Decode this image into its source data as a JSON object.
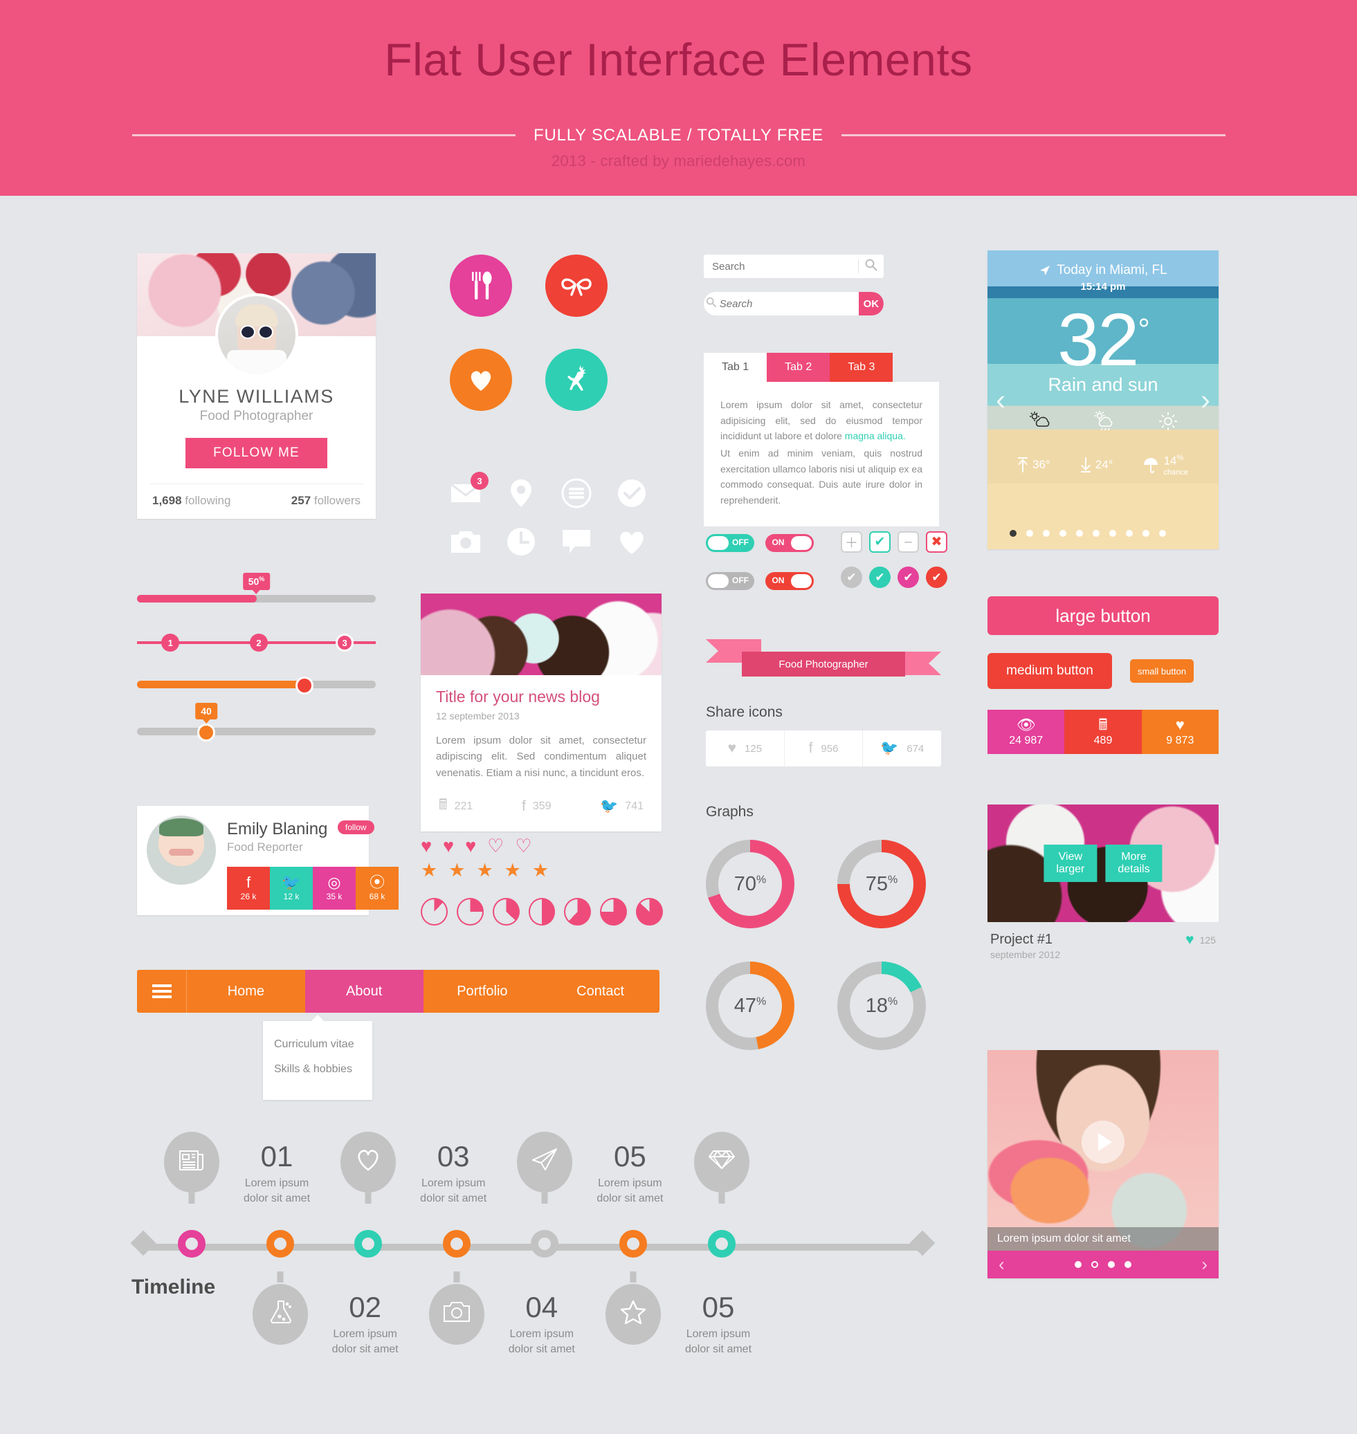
{
  "header": {
    "title": "Flat User Interface Elements",
    "subtitle": "FULLY SCALABLE / TOTALLY FREE",
    "credit": "2013 - crafted by mariedehayes.com"
  },
  "profile": {
    "name": "LYNE WILLIAMS",
    "role": "Food Photographer",
    "follow_label": "FOLLOW ME",
    "following_count": "1,698",
    "following_label": "following",
    "followers_count": "257",
    "followers_label": "followers"
  },
  "sliders": [
    {
      "tooltip": "50",
      "tooltip_sup": "%",
      "fill_pct": 50,
      "color": "#ee4b7b",
      "type": "progress"
    },
    {
      "type": "steps",
      "steps": [
        "1",
        "2",
        "3"
      ],
      "active_index": 2,
      "color": "#ee4b7b"
    },
    {
      "fill_pct": 70,
      "color": "#f57c20",
      "knob_color": "#ef4136",
      "type": "knob"
    },
    {
      "tooltip": "40",
      "tooltip_sup": "",
      "fill_pct": 29,
      "color": "#f57c20",
      "type": "bubble"
    }
  ],
  "emily": {
    "name": "Emily Blaning",
    "follow_label": "follow",
    "role": "Food Reporter",
    "socials": [
      {
        "icon": "facebook-icon",
        "glyph": "f",
        "count": "26 k",
        "color": "#ef4136"
      },
      {
        "icon": "twitter-icon",
        "glyph": "ᵕ",
        "count": "12 k",
        "color": "#2fcfb3"
      },
      {
        "icon": "dribbble-icon",
        "glyph": "◎",
        "count": "35 k",
        "color": "#e5409a"
      },
      {
        "icon": "rss-icon",
        "glyph": "✦",
        "count": "68 k",
        "color": "#f57c20"
      }
    ]
  },
  "round_icons": [
    {
      "name": "cutlery-icon",
      "glyph": "🍴",
      "color": "#e5409a"
    },
    {
      "name": "bow-icon",
      "glyph": "ᵔ",
      "color": "#ef4136"
    },
    {
      "name": "heart-icon",
      "glyph": "♥",
      "color": "#f57c20"
    },
    {
      "name": "deer-icon",
      "glyph": "ᵔ",
      "color": "#2fcfb3"
    }
  ],
  "flat_icons": [
    {
      "name": "envelope-icon",
      "glyph": "✉",
      "badge": "3"
    },
    {
      "name": "location-pin-icon",
      "glyph": "⬤",
      "badge": ""
    },
    {
      "name": "menu-circle-icon",
      "glyph": "≡",
      "badge": ""
    },
    {
      "name": "check-circle-icon",
      "glyph": "✔",
      "badge": ""
    },
    {
      "name": "camera-icon",
      "glyph": "■",
      "badge": ""
    },
    {
      "name": "clock-icon",
      "glyph": "●",
      "badge": ""
    },
    {
      "name": "comment-icon",
      "glyph": "■",
      "badge": ""
    },
    {
      "name": "heart-outline-icon",
      "glyph": "♥",
      "badge": ""
    }
  ],
  "news": {
    "title": "Title for your news blog",
    "date": "12 september 2013",
    "text": "Lorem ipsum dolor sit amet, consectetur adipiscing elit. Sed condimentum aliquet venenatis. Etiam a nisi nunc, a tincidunt eros.",
    "stats": [
      {
        "icon": "comment-icon",
        "glyph": "▣",
        "value": "221"
      },
      {
        "icon": "facebook-icon",
        "glyph": "f",
        "value": "359"
      },
      {
        "icon": "twitter-icon",
        "glyph": "ᵕ",
        "value": "741"
      }
    ]
  },
  "ratings": {
    "hearts": [
      "♥",
      "♥",
      "♥",
      "♡",
      "♡"
    ],
    "hearts_filled": 2,
    "hearts_half": 1,
    "stars": [
      "★",
      "★",
      "★",
      "★",
      "★"
    ],
    "pie_values": [
      12,
      25,
      37,
      50,
      62,
      75,
      87
    ]
  },
  "nav": {
    "burger": "menu-icon",
    "items": [
      "Home",
      "About",
      "Portfolio",
      "Contact"
    ],
    "active_index": 1,
    "dropdown": [
      "Curriculum vitae",
      "Skills & hobbies"
    ]
  },
  "timeline": {
    "label": "Timeline",
    "ring_colors": [
      "#e5409a",
      "#f57c20",
      "#2fcfb3",
      "#f57c20",
      "#c3c3c3",
      "#f57c20",
      "#2fcfb3"
    ],
    "items": [
      {
        "num": "01",
        "text": "Lorem ipsum\ndolor sit amet",
        "icon": "newspaper-icon",
        "glyph": "☷",
        "position": "top"
      },
      {
        "num": "02",
        "text": "Lorem ipsum\ndolor sit amet",
        "icon": "flask-icon",
        "glyph": "⚗",
        "position": "bottom"
      },
      {
        "num": "03",
        "text": "Lorem ipsum\ndolor sit amet",
        "icon": "heart-outline-icon",
        "glyph": "♡",
        "position": "top"
      },
      {
        "num": "04",
        "text": "Lorem ipsum\ndolor sit amet",
        "icon": "camera-icon",
        "glyph": "▢",
        "position": "bottom"
      },
      {
        "num": "05",
        "text": "Lorem ipsum\ndolor sit amet",
        "icon": "paper-plane-icon",
        "glyph": "➤",
        "position": "top"
      },
      {
        "num": "05",
        "text": "Lorem ipsum\ndolor sit amet",
        "icon": "star-outline-icon",
        "glyph": "☆",
        "position": "bottom"
      },
      {
        "num": "",
        "text": "",
        "icon": "diamond-icon",
        "glyph": "◆",
        "position": "top"
      }
    ]
  },
  "search": {
    "placeholder1": "Search",
    "placeholder2": "Search",
    "ok_label": "OK",
    "search_icon": "magnifier-icon"
  },
  "tabs": {
    "items": [
      "Tab 1",
      "Tab 2",
      "Tab 3"
    ],
    "active_index": 0,
    "body_p1_a": "Lorem ipsum dolor sit amet, consectetur adipisicing elit, sed do eiusmod tempor incididunt ut labore et dolore ",
    "body_link": "magna aliqua.",
    "body_p2": "Ut enim ad minim veniam, quis nostrud exercitation ullamco laboris nisi ut aliquip ex ea commodo consequat. Duis aute irure dolor in reprehenderit."
  },
  "toggles": [
    {
      "state": "OFF",
      "color": "#2fcfb3"
    },
    {
      "state": "ON",
      "color": "#ee4b7b"
    },
    {
      "state": "OFF",
      "color": "#b6b6b6"
    },
    {
      "state": "ON",
      "color": "#ef4136"
    }
  ],
  "checkboxes_square": [
    {
      "name": "plus-checkbox",
      "glyph": "＋",
      "color": "#b6b6b6",
      "border": "#d0d0d0"
    },
    {
      "name": "check-checkbox",
      "glyph": "✔",
      "color": "#2fcfb3",
      "border": "#2fcfb3"
    },
    {
      "name": "minus-checkbox",
      "glyph": "–",
      "color": "#b6b6b6",
      "border": "#d0d0d0"
    },
    {
      "name": "cross-checkbox",
      "glyph": "✖",
      "color": "#ef4136",
      "border": "#ee4b7b"
    }
  ],
  "checkboxes_round": [
    {
      "name": "check-round-grey",
      "glyph": "✔",
      "color": "#c3c3c3"
    },
    {
      "name": "check-round-teal",
      "glyph": "✔",
      "color": "#2fcfb3"
    },
    {
      "name": "check-round-pink",
      "glyph": "✔",
      "color": "#e5409a"
    },
    {
      "name": "check-round-red",
      "glyph": "✔",
      "color": "#ef4136"
    }
  ],
  "ribbon": {
    "text": "Food Photographer"
  },
  "share": {
    "title": "Share icons",
    "items": [
      {
        "icon": "heart-icon",
        "glyph": "♥",
        "value": "125"
      },
      {
        "icon": "facebook-icon",
        "glyph": "f",
        "value": "956"
      },
      {
        "icon": "twitter-icon",
        "glyph": "ᵕ",
        "value": "674"
      }
    ]
  },
  "chart_data": {
    "type": "pie",
    "title": "Graphs",
    "charts": [
      {
        "label": "70",
        "sup": "%",
        "value": 70,
        "color": "#ee4b7b",
        "track": "#c3c3c3"
      },
      {
        "label": "75",
        "sup": "%",
        "value": 75,
        "color": "#ef4136",
        "track": "#c3c3c3"
      },
      {
        "label": "47",
        "sup": "%",
        "value": 47,
        "color": "#f57c20",
        "track": "#c3c3c3"
      },
      {
        "label": "18",
        "sup": "%",
        "value": 18,
        "color": "#2fcfb3",
        "track": "#c3c3c3"
      }
    ],
    "legend": [],
    "ylim": [
      0,
      100
    ]
  },
  "weather": {
    "location": "Today in Miami, FL",
    "time": "15:14  pm",
    "temp": "32",
    "degree": "°",
    "condition": "Rain and sun",
    "forecast_icons": [
      "partly-cloudy-icon",
      "rain-sun-icon",
      "sun-icon"
    ],
    "high_label": "36°",
    "low_label": "24°",
    "rain_label": "14",
    "rain_sup": "%",
    "rain_sub": "chance",
    "dots": 10,
    "active_dot": 0,
    "prev": "‹",
    "next": "›"
  },
  "buttons": {
    "large": "large button",
    "medium": "medium button",
    "small": "small button",
    "stats": [
      {
        "icon": "eye-icon",
        "glyph": "◉",
        "value": "24 987",
        "color": "#e5409a"
      },
      {
        "icon": "comment-icon",
        "glyph": "▣",
        "value": "489",
        "color": "#ef4136"
      },
      {
        "icon": "heart-icon",
        "glyph": "♥",
        "value": "9 873",
        "color": "#f57c20"
      }
    ]
  },
  "project": {
    "view_larger": "View larger",
    "more_details": "More details",
    "title": "Project #1",
    "date": "september 2012",
    "likes": "125"
  },
  "video_slider": {
    "caption": "Lorem ipsum dolor sit amet",
    "dots": 4,
    "active_dot": 1,
    "prev": "‹",
    "next": "›",
    "play": "play-icon"
  },
  "colors": {
    "pink": "#ee4b7b",
    "magenta": "#e5409a",
    "red": "#ef4136",
    "orange": "#f57c20",
    "teal": "#2fcfb3",
    "grey": "#c3c3c3",
    "bg": "#e4e6e9",
    "header_bg": "#ee547f",
    "header_title": "#a8204b"
  }
}
